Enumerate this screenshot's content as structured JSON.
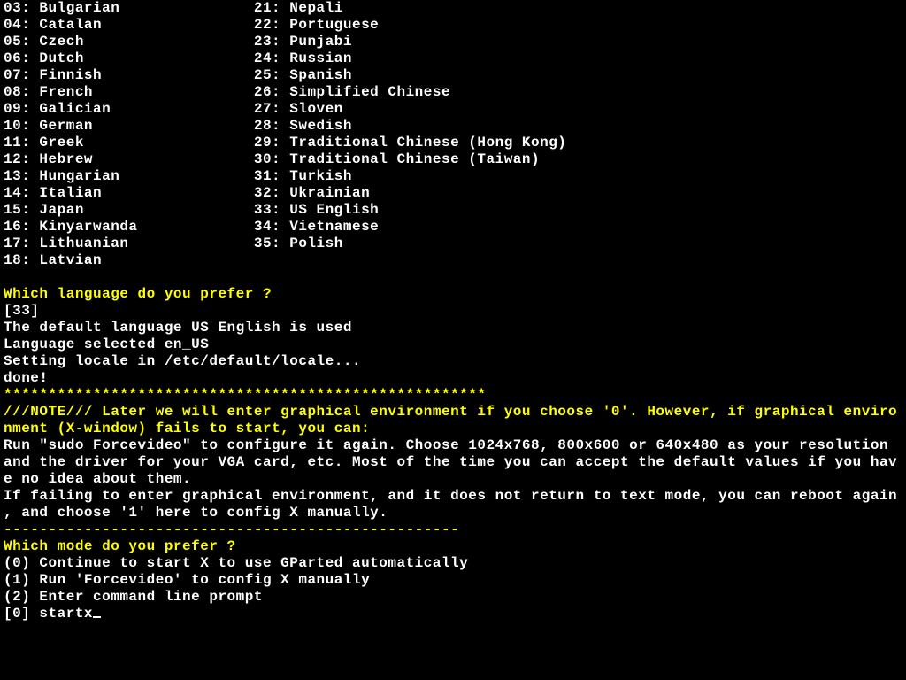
{
  "lang_left": [
    {
      "num": "03",
      "name": "Bulgarian"
    },
    {
      "num": "04",
      "name": "Catalan"
    },
    {
      "num": "05",
      "name": "Czech"
    },
    {
      "num": "06",
      "name": "Dutch"
    },
    {
      "num": "07",
      "name": "Finnish"
    },
    {
      "num": "08",
      "name": "French"
    },
    {
      "num": "09",
      "name": "Galician"
    },
    {
      "num": "10",
      "name": "German"
    },
    {
      "num": "11",
      "name": "Greek"
    },
    {
      "num": "12",
      "name": "Hebrew"
    },
    {
      "num": "13",
      "name": "Hungarian"
    },
    {
      "num": "14",
      "name": "Italian"
    },
    {
      "num": "15",
      "name": "Japan"
    },
    {
      "num": "16",
      "name": "Kinyarwanda"
    },
    {
      "num": "17",
      "name": "Lithuanian"
    },
    {
      "num": "18",
      "name": "Latvian"
    }
  ],
  "lang_right": [
    {
      "num": "21",
      "name": "Nepali"
    },
    {
      "num": "22",
      "name": "Portuguese"
    },
    {
      "num": "23",
      "name": "Punjabi"
    },
    {
      "num": "24",
      "name": "Russian"
    },
    {
      "num": "25",
      "name": "Spanish"
    },
    {
      "num": "26",
      "name": "Simplified Chinese"
    },
    {
      "num": "27",
      "name": "Sloven"
    },
    {
      "num": "28",
      "name": "Swedish"
    },
    {
      "num": "29",
      "name": "Traditional Chinese (Hong Kong)"
    },
    {
      "num": "30",
      "name": "Traditional Chinese (Taiwan)"
    },
    {
      "num": "31",
      "name": "Turkish"
    },
    {
      "num": "32",
      "name": "Ukrainian"
    },
    {
      "num": "33",
      "name": "US English"
    },
    {
      "num": "34",
      "name": "Vietnamese"
    },
    {
      "num": "35",
      "name": "Polish"
    }
  ],
  "prompt_lang": "Which language do you prefer ?",
  "lang_answer": "[33]",
  "msg_default": "The default language US English is used",
  "msg_selected": "Language selected en_US",
  "msg_setting": "Setting locale in /etc/default/locale...",
  "msg_done": "done!",
  "stars": "******************************************************",
  "note_l1": "///NOTE/// Later we will enter graphical environment if you choose '0'. However, if graphical enviro",
  "note_l2": "nment (X-window) fails to start, you can:",
  "hint_l1": "Run \"sudo Forcevideo\" to configure it again. Choose 1024x768, 800x600 or 640x480 as your resolution ",
  "hint_l2": "and the driver for your VGA card, etc. Most of the time you can accept the default values if you hav",
  "hint_l3": "e no idea about them.",
  "hint_l4": "If failing to enter graphical environment, and it does not return to text mode, you can reboot again",
  "hint_l5": ", and choose '1' here to config X manually.",
  "dashes": "---------------------------------------------------",
  "prompt_mode": "Which mode do you prefer ?",
  "opt0": "(0) Continue to start X to use GParted automatically",
  "opt1": "(1) Run 'Forcevideo' to config X manually",
  "opt2": "(2) Enter command line prompt",
  "mode_answer": "[0] startx"
}
